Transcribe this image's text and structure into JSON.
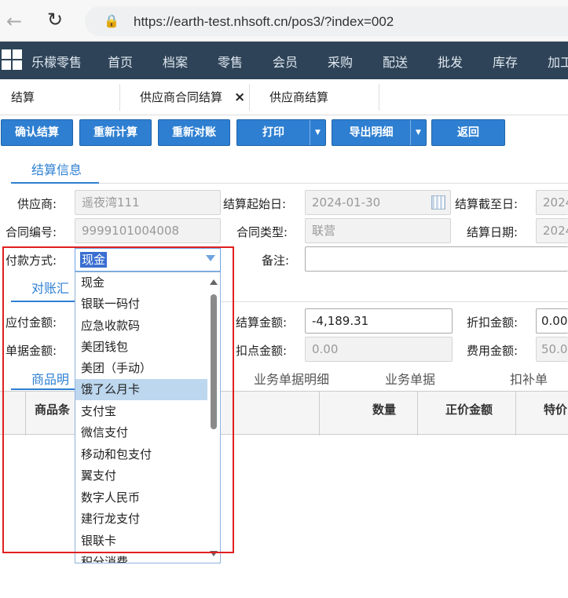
{
  "browser": {
    "url": "https://earth-test.nhsoft.cn/pos3/?index=002"
  },
  "nav": {
    "brand": "乐檬零售",
    "items": [
      "首页",
      "档案",
      "零售",
      "会员",
      "采购",
      "配送",
      "批发",
      "库存",
      "加工"
    ]
  },
  "tabs": {
    "items": [
      "结算",
      "供应商合同结算",
      "供应商结算"
    ],
    "active_index": 1,
    "close_glyph": "×"
  },
  "toolbar": {
    "confirm": "确认结算",
    "recalc": "重新计算",
    "recheck": "重新对账",
    "print": "打印",
    "export": "导出明细",
    "back": "返回"
  },
  "sections": {
    "settle_info": "结算信息",
    "reconcile": "对账汇"
  },
  "form": {
    "supplier_label": "供应商:",
    "supplier_value": "遥夜湾111",
    "start_label": "结算起始日:",
    "start_value": "2024-01-30",
    "end_label": "结算截至日:",
    "end_value": "2024",
    "contract_no_label": "合同编号:",
    "contract_no_value": "9999101004008",
    "contract_type_label": "合同类型:",
    "contract_type_value": "联营",
    "settle_date_label": "结算日期:",
    "settle_date_value": "2024",
    "pay_label": "付款方式:",
    "pay_value": "现金",
    "note_label": "备注:",
    "payable_label": "应付金额:",
    "settle_amount_label": "结算金额:",
    "settle_amount_value": "-4,189.31",
    "discount_label": "折扣金额:",
    "discount_value": "0.00",
    "doc_amount_label": "单据金额:",
    "deduct_label": "扣点金额:",
    "deduct_value": "0.00",
    "fee_label": "费用金额:",
    "fee_value": "50.0"
  },
  "dropdown": {
    "items": [
      "现金",
      "银联一码付",
      "应急收款码",
      "美团钱包",
      "美团（手动）",
      "饿了么月卡",
      "支付宝",
      "微信支付",
      "移动和包支付",
      "翼支付",
      "数字人民币",
      "建行龙支付",
      "银联卡",
      "积分消费"
    ],
    "highlighted_index": 5
  },
  "detail_tabs": {
    "goods": "商品明",
    "biz_detail": "业务单据明细",
    "biz_doc": "业务单据",
    "deduct": "扣补单"
  },
  "grid": {
    "headers": [
      "商品条",
      "数量",
      "正价金额",
      "特价"
    ]
  },
  "colors": {
    "accent": "#2e7fd1",
    "nav_bg": "#2e4357",
    "annotation": "#e02020",
    "highlight": "#bdd7ef"
  }
}
